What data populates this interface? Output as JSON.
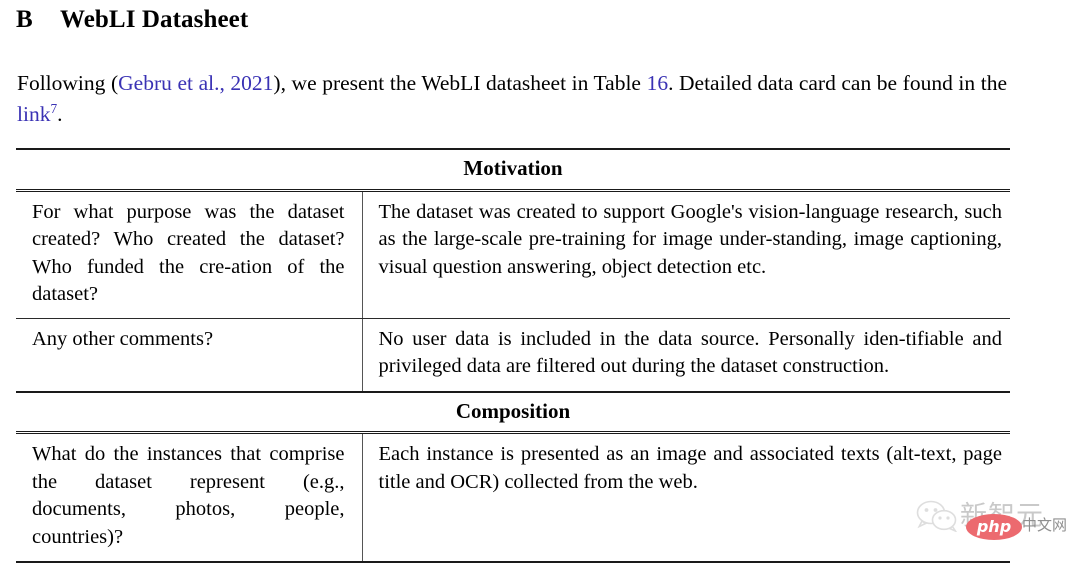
{
  "heading": {
    "number": "B",
    "title": "WebLI Datasheet"
  },
  "intro": {
    "part1": "Following (",
    "citation": "Gebru et al., 2021",
    "part2": "), we present the WebLI datasheet in Table ",
    "table_ref": "16",
    "part3": ". Detailed data card can be found in the ",
    "link_text": "link",
    "footnote_marker": "7",
    "part4": "."
  },
  "table": {
    "sections": [
      {
        "band": "Motivation",
        "rows": [
          {
            "question": "For what purpose was the dataset created? Who created the dataset? Who funded the cre-ation of the dataset?",
            "answer": "The dataset was created to support Google's vision-language research, such as the large-scale pre-training for image under-standing, image captioning, visual question answering, object detection etc."
          },
          {
            "question": "Any other comments?",
            "answer": "No user data is included in the data source. Personally iden-tifiable and privileged data are filtered out during the dataset construction."
          }
        ]
      },
      {
        "band": "Composition",
        "rows": [
          {
            "question": "What do the instances that comprise the dataset represent (e.g., documents, photos, people, countries)?",
            "answer": "Each instance is presented as an image and associated texts (alt-text, page title and OCR) collected from the web."
          }
        ]
      }
    ]
  },
  "watermark": {
    "brand_cn": "新智元",
    "suffix_cn": "中文网",
    "badge": "php"
  },
  "colors": {
    "link": "#3a32b4",
    "rule": "#1a1a1a",
    "badge_red": "#ec6a6f",
    "watermark_gray": "#c9c9c9"
  }
}
